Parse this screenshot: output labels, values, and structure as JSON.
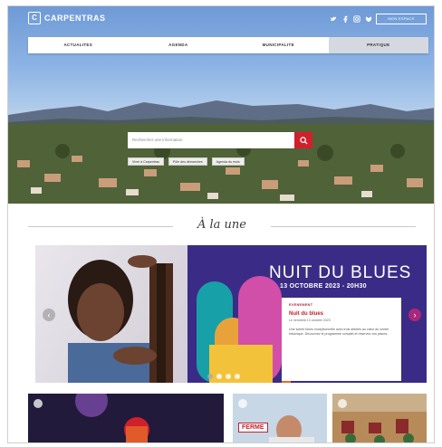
{
  "header": {
    "logo_text": "CARPENTRAS",
    "social_icons": [
      "twitter-icon",
      "facebook-icon",
      "instagram-icon",
      "linkedin-icon"
    ],
    "espace_label": "MON ESPACE"
  },
  "nav": {
    "items": [
      {
        "label": "ACTUALITES"
      },
      {
        "label": "AGENDA"
      },
      {
        "label": "MUNICIPALITE"
      },
      {
        "label": "PRATIQUE"
      }
    ],
    "active_index": 3
  },
  "search": {
    "placeholder": "Rechercher une information"
  },
  "quick_links": [
    {
      "label": "Vivre à Carpentras"
    },
    {
      "label": "Pôle des démarches"
    },
    {
      "label": "Agenda du mois"
    }
  ],
  "section": {
    "title": "À la une"
  },
  "carousel": {
    "poster_title": "NUIT DU BLUES",
    "poster_date": "13 OCTOBRE 2023 - 20H30",
    "card_tag": "EVENEMENT",
    "card_title": "Nuit du blues",
    "card_subtitle": "Le vendredi 13 octobre 2023",
    "card_text": "Une soirée blues exceptionnelle avec trois artistes au cœur du centre historique. Découvrez le programme complet et réservez vos places.",
    "slide_count": 4,
    "active_slide": 0,
    "colors": {
      "poster_bg": "#3a2c86",
      "accent": "#c0202c",
      "next_arrow": "#be2878"
    }
  },
  "news": [
    {
      "label": ""
    },
    {
      "badge_text": "FERME"
    },
    {
      "label": ""
    }
  ],
  "colors": {
    "brand_red": "#d0202c",
    "nav_active": "#d5d9df"
  }
}
